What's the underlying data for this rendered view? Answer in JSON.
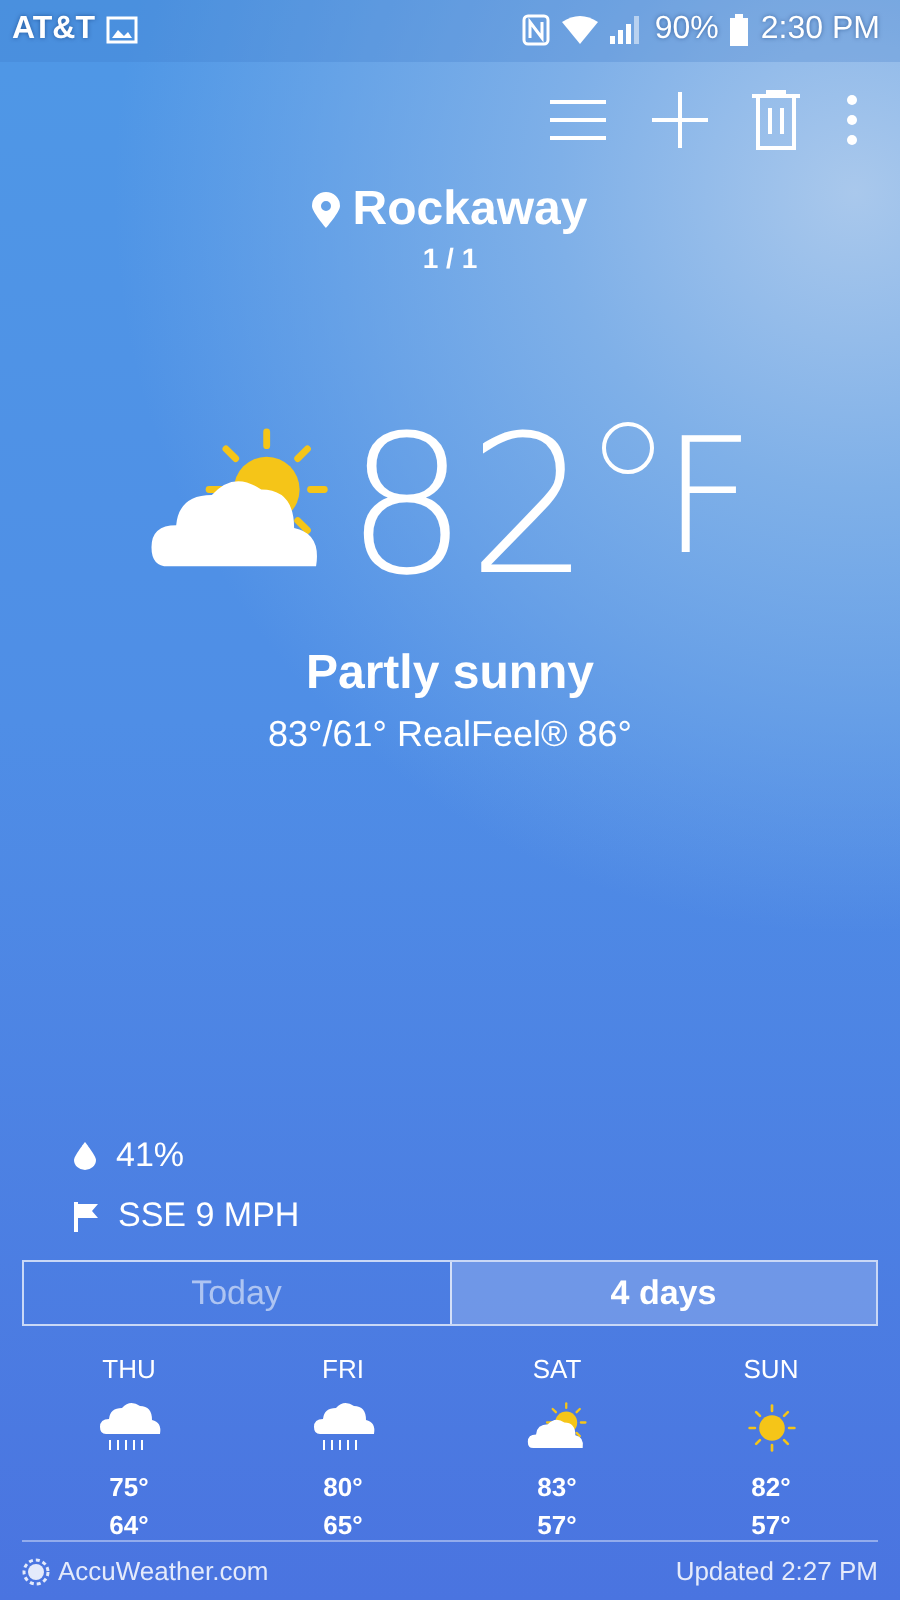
{
  "status_bar": {
    "carrier": "AT&T",
    "battery": "90%",
    "time": "2:30 PM"
  },
  "location": {
    "name": "Rockaway",
    "page": "1 / 1"
  },
  "current": {
    "kind": "partly_sunny",
    "temperature": "82",
    "unit": "F",
    "condition": "Partly sunny",
    "details": "83°/61° RealFeel® 86°"
  },
  "humidity": "41%",
  "wind": "SSE 9 MPH",
  "tabs": [
    {
      "label": "Today",
      "selected": false
    },
    {
      "label": "4 days",
      "selected": true
    }
  ],
  "forecast": [
    {
      "day": "THU",
      "kind": "rain",
      "high": "75°",
      "low": "64°"
    },
    {
      "day": "FRI",
      "kind": "rain",
      "high": "80°",
      "low": "65°"
    },
    {
      "day": "SAT",
      "kind": "partly_sunny",
      "high": "83°",
      "low": "57°"
    },
    {
      "day": "SUN",
      "kind": "sunny",
      "high": "82°",
      "low": "57°"
    }
  ],
  "footer": {
    "source": "AccuWeather.com",
    "updated": "Updated 2:27 PM"
  }
}
